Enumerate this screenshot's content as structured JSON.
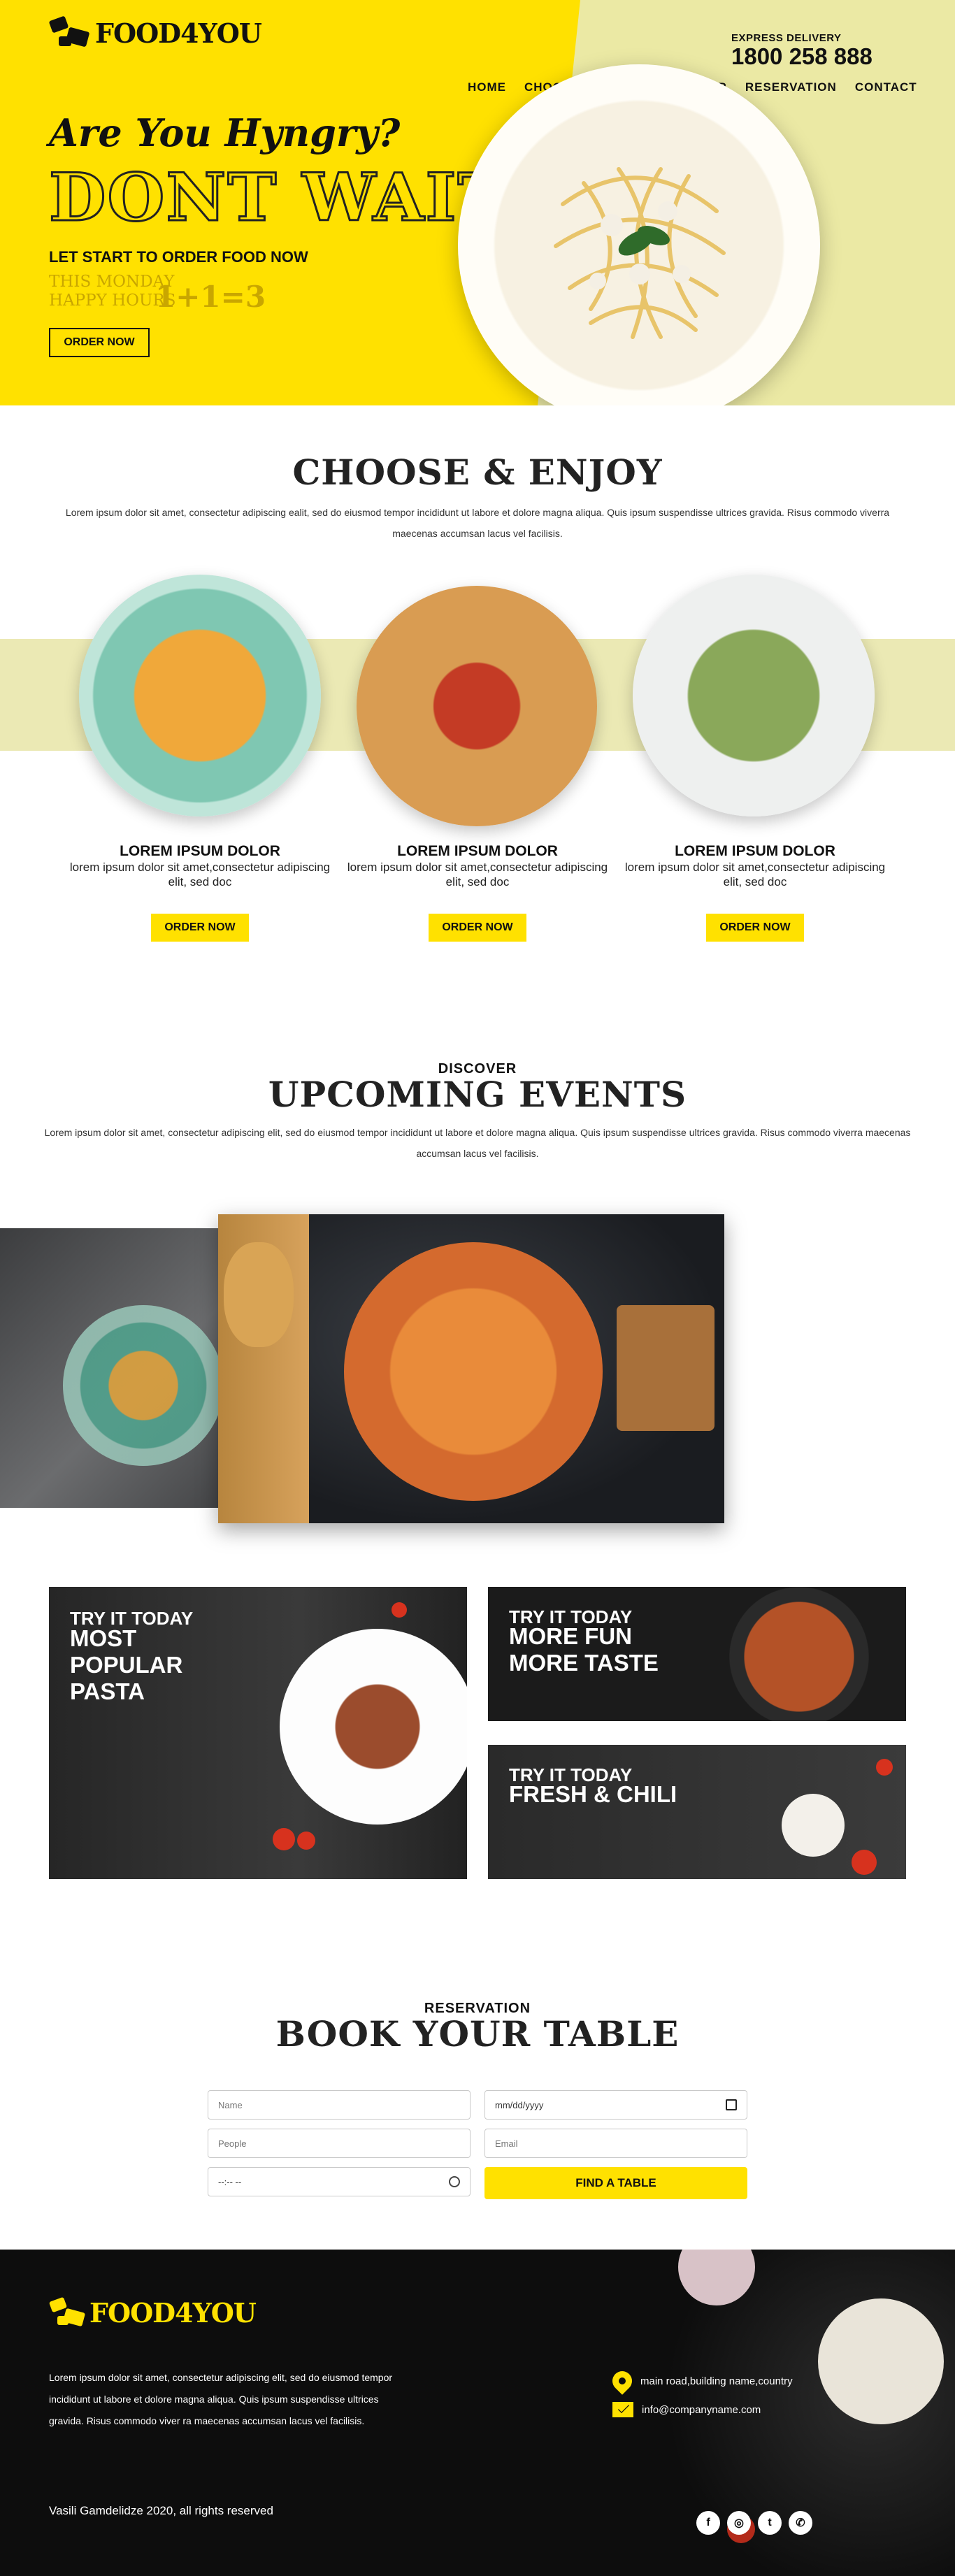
{
  "hero": {
    "logo": "FOOD4YOU",
    "express_label": "EXPRESS DELIVERY",
    "phone": "1800 258 888",
    "nav": [
      "HOME",
      "CHOOSE & ENJOY",
      "DISCOVER",
      "RESERVATION",
      "CONTACT"
    ],
    "headline": "Are You Hyngry?",
    "big_headline": "DONT WAIT!",
    "subline": "LET START TO ORDER FOOD NOW",
    "monday": "THIS MONDAY",
    "happy_hours": "HAPPY HOURS",
    "deal": "1+1=3",
    "cta": "ORDER NOW"
  },
  "choose": {
    "title": "CHOOSE & ENJOY",
    "text": "Lorem ipsum dolor sit amet, consectetur adipiscing ealit, sed do eiusmod tempor incididunt ut labore et dolore magna aliqua. Quis ipsum suspendisse ultrices gravida. Risus commodo viverra maecenas accumsan lacus vel facilisis.",
    "cards": [
      {
        "title": "LOREM IPSUM DOLOR",
        "desc": "lorem ipsum dolor sit amet,consectetur adipiscing elit, sed doc",
        "button": "ORDER NOW"
      },
      {
        "title": "LOREM IPSUM DOLOR",
        "desc": "lorem ipsum dolor sit amet,consectetur adipiscing elit, sed doc",
        "button": "ORDER NOW"
      },
      {
        "title": "LOREM IPSUM DOLOR",
        "desc": "lorem ipsum dolor sit amet,consectetur adipiscing elit, sed doc",
        "button": "ORDER NOW"
      }
    ]
  },
  "events": {
    "eyebrow": "DISCOVER",
    "title": "UPCOMING EVENTS",
    "text": "Lorem ipsum dolor sit amet, consectetur adipiscing elit, sed do eiusmod tempor incididunt ut labore et dolore magna aliqua. Quis ipsum suspendisse ultrices gravida. Risus commodo viverra maecenas accumsan lacus vel facilisis."
  },
  "promos": [
    {
      "kicker": "TRY IT TODAY",
      "line1": "MOST",
      "line2": "POPULAR",
      "line3": "PASTA"
    },
    {
      "kicker": "TRY IT TODAY",
      "line1": "MORE FUN",
      "line2": "MORE TASTE"
    },
    {
      "kicker": "TRY IT TODAY",
      "line1": "FRESH & CHILI"
    }
  ],
  "reservation": {
    "eyebrow": "RESERVATION",
    "title": "BOOK YOUR TABLE",
    "name_placeholder": "Name",
    "date_value": "mm/dd/yyyy",
    "people_placeholder": "People",
    "email_placeholder": "Email",
    "time_value": "--:-- --",
    "button": "FIND A TABLE"
  },
  "footer": {
    "logo": "FOOD4YOU",
    "text": "Lorem ipsum dolor sit amet, consectetur adipiscing elit, sed do eiusmod tempor incididunt ut labore et dolore magna aliqua. Quis ipsum suspendisse ultrices gravida. Risus commodo viver ra maecenas accumsan lacus vel facilisis.",
    "address": "main road,building name,country",
    "email": "info@companyname.com",
    "copyright": "Vasili Gamdelidze 2020, all rights reserved",
    "social_icons": [
      "facebook-icon",
      "instagram-icon",
      "twitter-icon",
      "whatsapp-icon"
    ]
  },
  "colors": {
    "accent": "#ffe100",
    "soft_band": "#ebe9b4",
    "footer_bg": "#0d0d0d"
  }
}
